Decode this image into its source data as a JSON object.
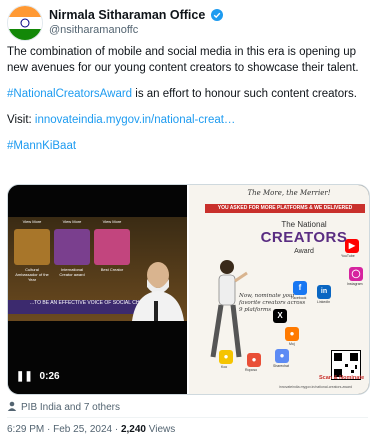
{
  "account": {
    "name": "Nirmala Sitharaman Office",
    "handle": "@nsitharamanoffc"
  },
  "tweet": {
    "line1": "The combination of mobile and social media in this era is opening up new avenues for our young content creators to showcase their talent.",
    "hashtag_award": "#NationalCreatorsAward",
    "line2_rest": " is an effort to honour such content creators.",
    "visit_label": "Visit:  ",
    "visit_link": "innovateindia.mygov.in/national-creat…",
    "hashtag_mkb": "#MannKiBaat"
  },
  "video": {
    "elapsed": "0:26",
    "banner": "...TO BE AN EFFECTIVE VOICE OF SOCIAL CHANGE",
    "tiles": [
      "View More",
      "View More",
      "View More"
    ],
    "tile_labels": [
      "Cultural Ambassador of the Year",
      "International Creator award",
      "Best Creator"
    ]
  },
  "poster": {
    "title": "The More, the Merrier!",
    "bar": "YOU ASKED FOR MORE PLATFORMS & WE DELIVERED",
    "the_national": "The National",
    "creators": "CREATORS",
    "award": "Award",
    "handwritten": "Now, nominate your favorite creators across 9 platforms",
    "platforms": [
      "YouTube",
      "Instagram",
      "Facebook",
      "LinkedIn",
      "X",
      "Moj",
      "Koo",
      "Roposo",
      "Sharechat"
    ],
    "scan": "Scan & Nominate",
    "url": "innovateindia.mygov.in/national-creators-award"
  },
  "footer": {
    "repost": "PIB India and 7 others",
    "time": "6:29 PM · Feb 25, 2024 · ",
    "views_count": "2,240",
    "views_label": " Views"
  },
  "colors": {
    "link": "#1d9bf0",
    "verified": "#1d9bf0",
    "poster_bar": "#c9302c",
    "creators": "#5a2d82"
  }
}
